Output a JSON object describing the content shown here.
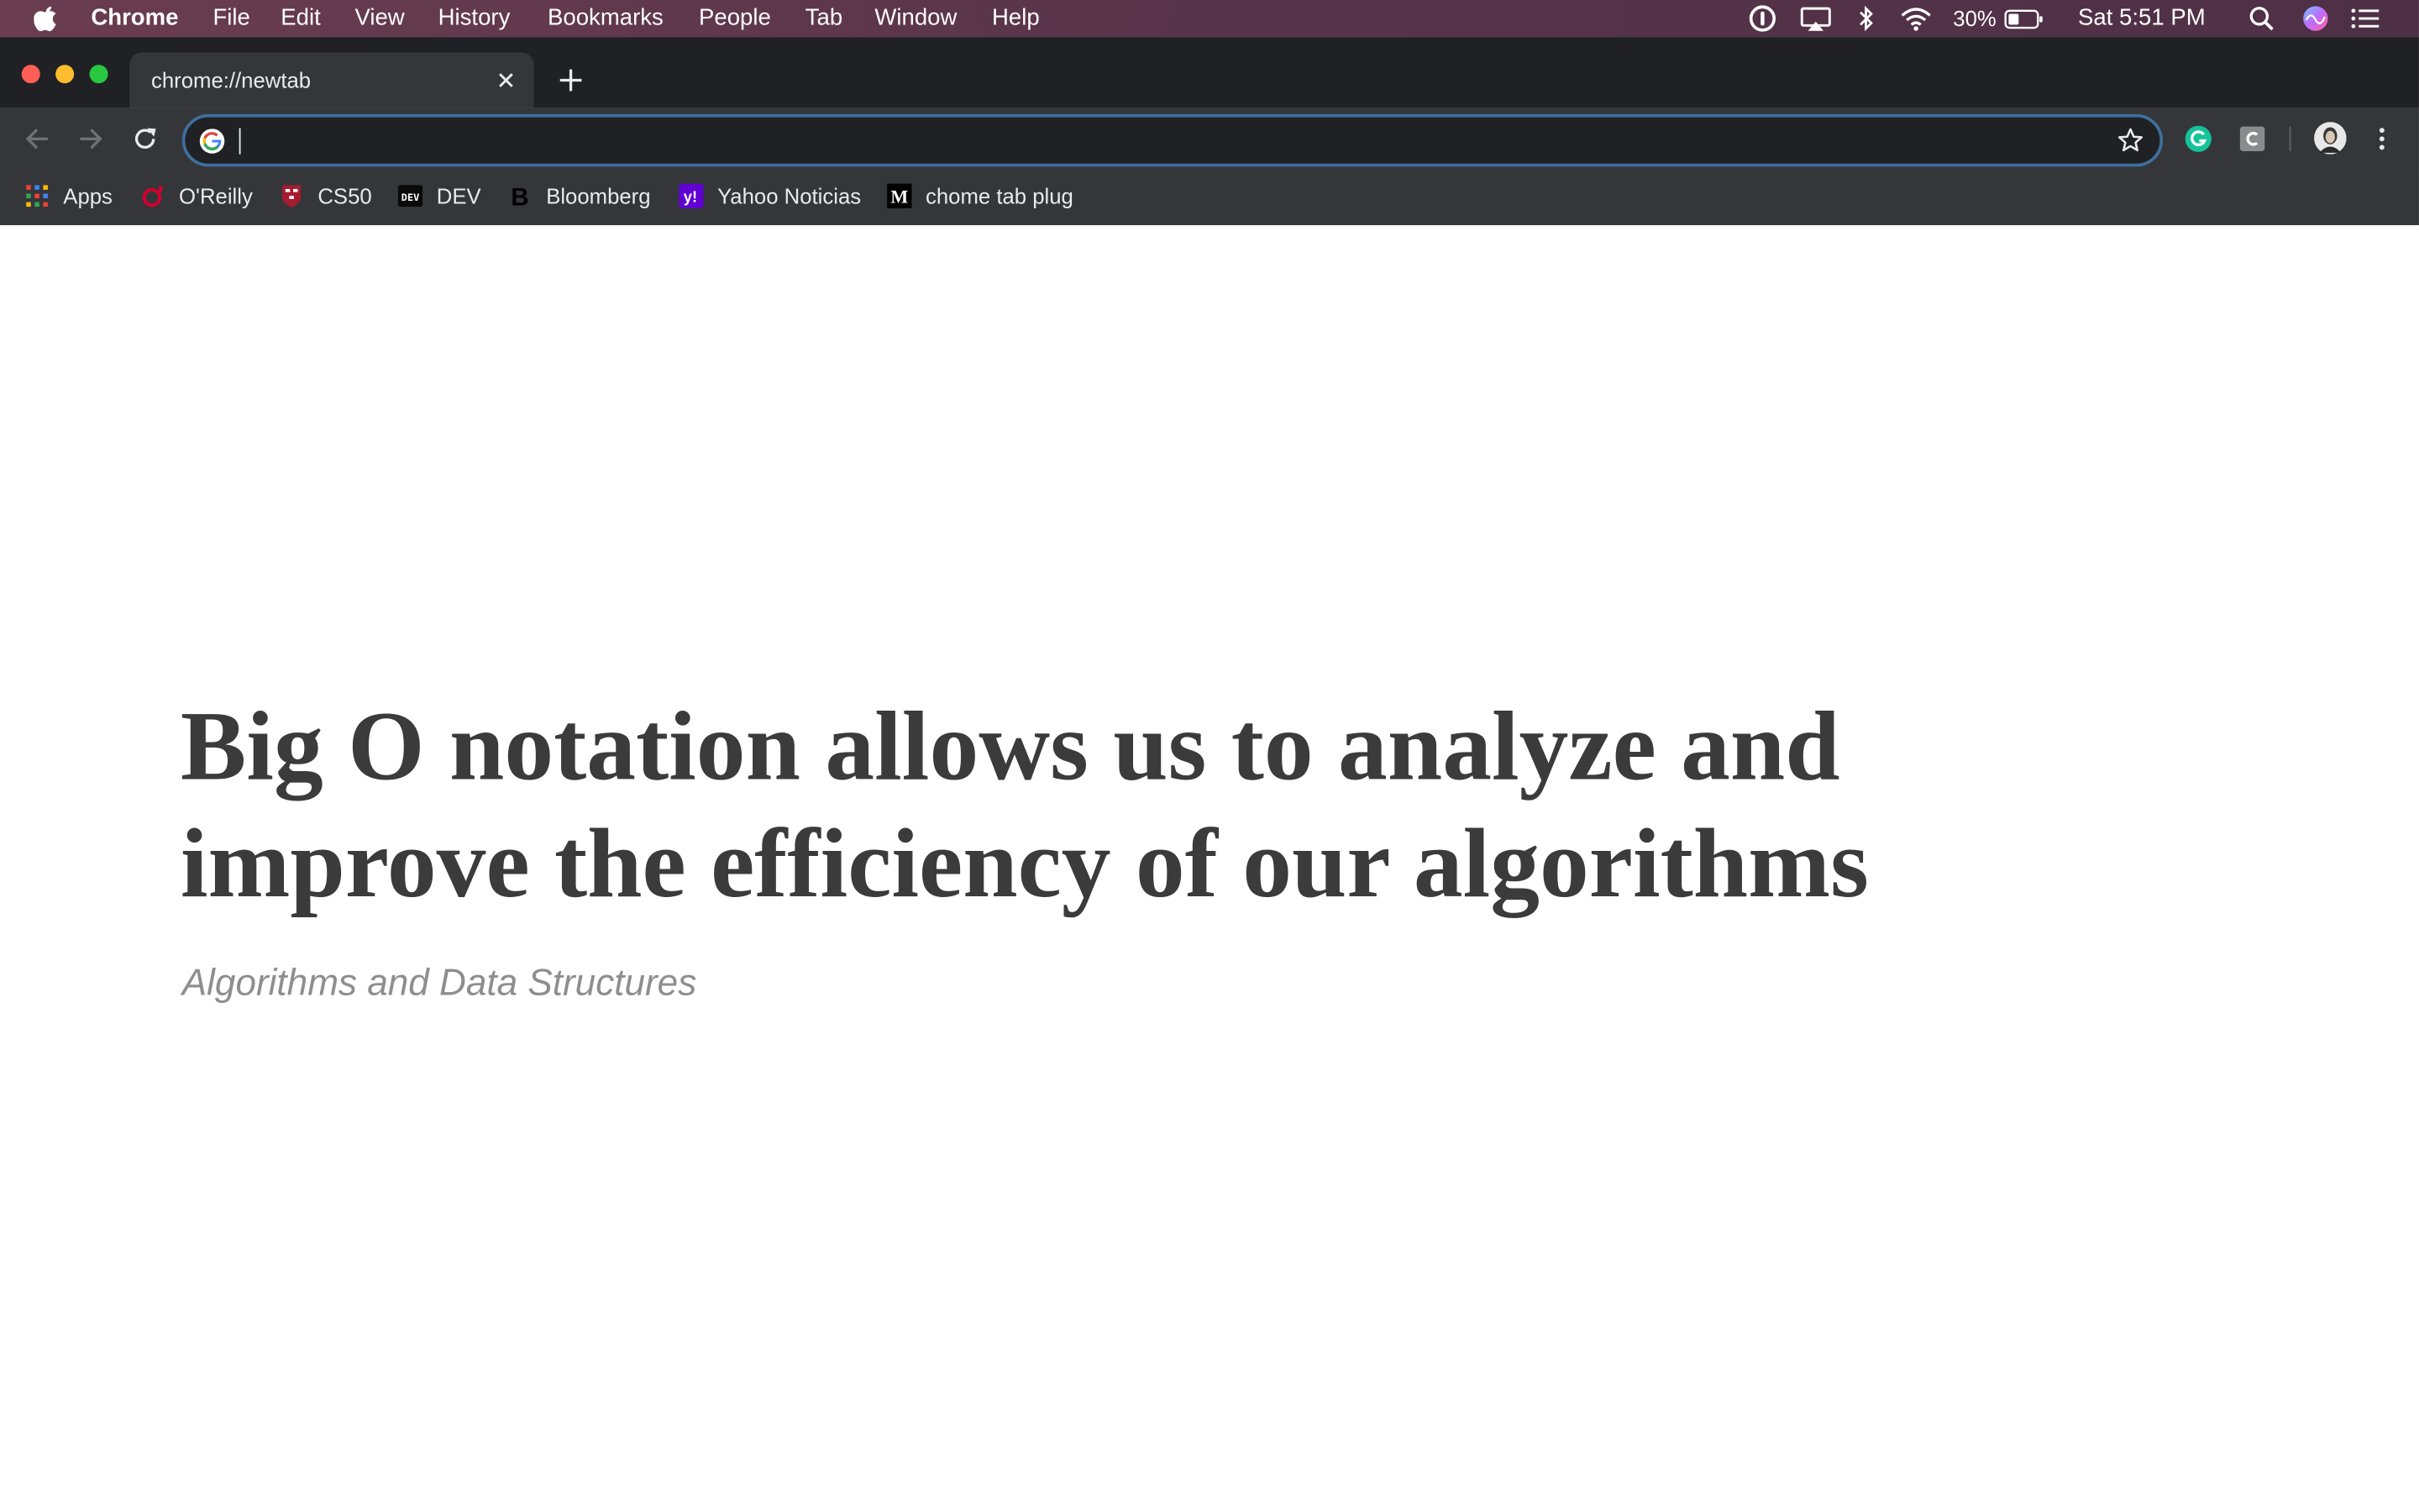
{
  "menubar": {
    "app_name": "Chrome",
    "menus": [
      "File",
      "Edit",
      "View",
      "History",
      "Bookmarks",
      "People",
      "Tab",
      "Window",
      "Help"
    ],
    "battery_percent": "30%",
    "clock": "Sat 5:51 PM",
    "status_icons": [
      "1password-icon",
      "airplay-icon",
      "bluetooth-icon",
      "wifi-icon",
      "battery-icon",
      "spotlight-icon",
      "siri-icon",
      "notification-center-icon"
    ]
  },
  "browser": {
    "tab": {
      "title": "chrome://newtab"
    },
    "omnibox": {
      "value": "",
      "placeholder": ""
    },
    "extensions": [
      "grammarly-icon",
      "c-extension-icon"
    ]
  },
  "bookmarks": [
    {
      "label": "Apps",
      "icon": "apps-grid-icon"
    },
    {
      "label": "O'Reilly",
      "icon": "oreilly-icon"
    },
    {
      "label": "CS50",
      "icon": "harvard-icon"
    },
    {
      "label": "DEV",
      "icon": "dev-icon"
    },
    {
      "label": "Bloomberg",
      "icon": "bloomberg-icon"
    },
    {
      "label": "Yahoo Noticias",
      "icon": "yahoo-icon"
    },
    {
      "label": "chome tab plug",
      "icon": "medium-icon"
    }
  ],
  "page": {
    "headline": "Big O notation allows us to analyze and improve the efficiency of our algorithms",
    "subtitle": "Algorithms and Data Structures"
  },
  "colors": {
    "menubar": "#5a3649",
    "tabstrip": "#202124",
    "toolbar": "#35363a",
    "omnibox_border": "#3e6f9e",
    "headline_text": "#3b3b3b",
    "subtitle_text": "#8e8e8e"
  }
}
